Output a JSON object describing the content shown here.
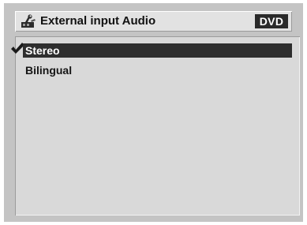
{
  "header": {
    "title": "External input Audio",
    "badge": "DVD",
    "icon": "settings-tool-icon"
  },
  "menu": {
    "selected_icon": "checkmark-icon",
    "items": [
      {
        "label": "Stereo",
        "selected": true
      },
      {
        "label": "Bilingual",
        "selected": false
      }
    ]
  },
  "colors": {
    "screen_bg": "#c4c4c4",
    "panel_bg": "#d9d9d9",
    "header_bg": "#e2e2e2",
    "highlight": "#2e2e2e",
    "badge_bg": "#2a2a2a"
  }
}
